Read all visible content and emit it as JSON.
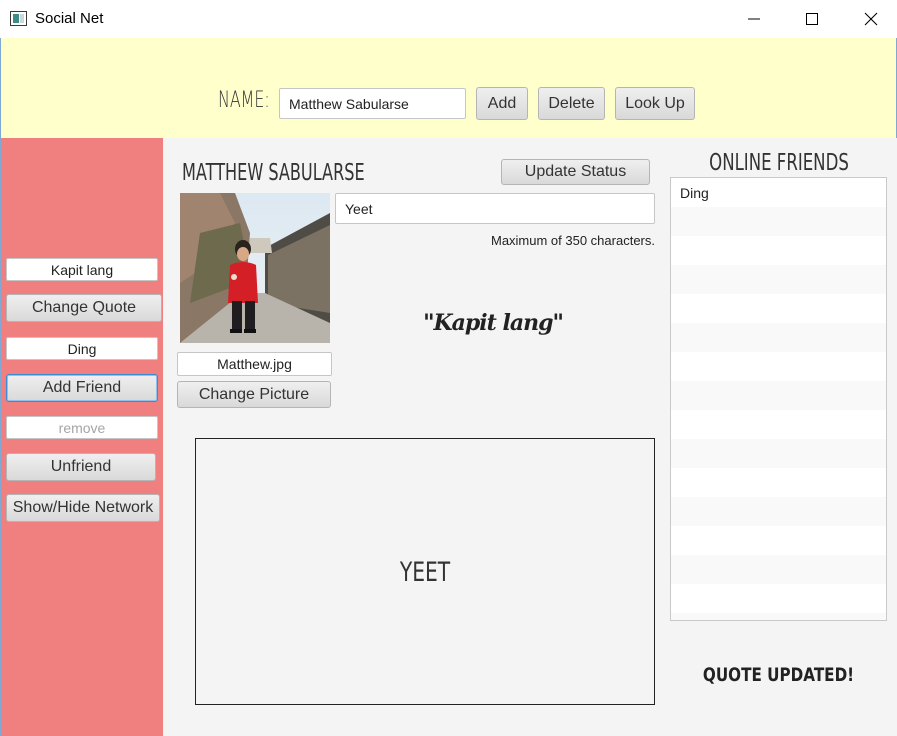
{
  "window": {
    "title": "Social Net",
    "icon": "app-window-icon"
  },
  "topbar": {
    "name_label": "NAME:",
    "name_input_value": "Matthew Sabularse",
    "add_label": "Add",
    "delete_label": "Delete",
    "lookup_label": "Look Up",
    "background_color": "#ffffcc"
  },
  "sidebar": {
    "background_color": "#f08080",
    "quote_input_value": "Kapit lang",
    "change_quote_label": "Change Quote",
    "friend_input_value": "Ding",
    "add_friend_label": "Add Friend",
    "remove_input_placeholder": "remove",
    "unfriend_label": "Unfriend",
    "show_hide_network_label": "Show/Hide Network"
  },
  "profile": {
    "name": "MATTHEW SABULARSE",
    "update_status_label": "Update Status",
    "status_input_value": "Yeet",
    "max_note": "Maximum of 350 characters.",
    "quote_display": "\"Kapit lang\"",
    "picture_filename": "Matthew.jpg",
    "change_picture_label": "Change Picture",
    "status_display": "YEET"
  },
  "online": {
    "title": "ONLINE FRIENDS",
    "friends": [
      "Ding"
    ]
  },
  "notification": "QUOTE UPDATED!"
}
